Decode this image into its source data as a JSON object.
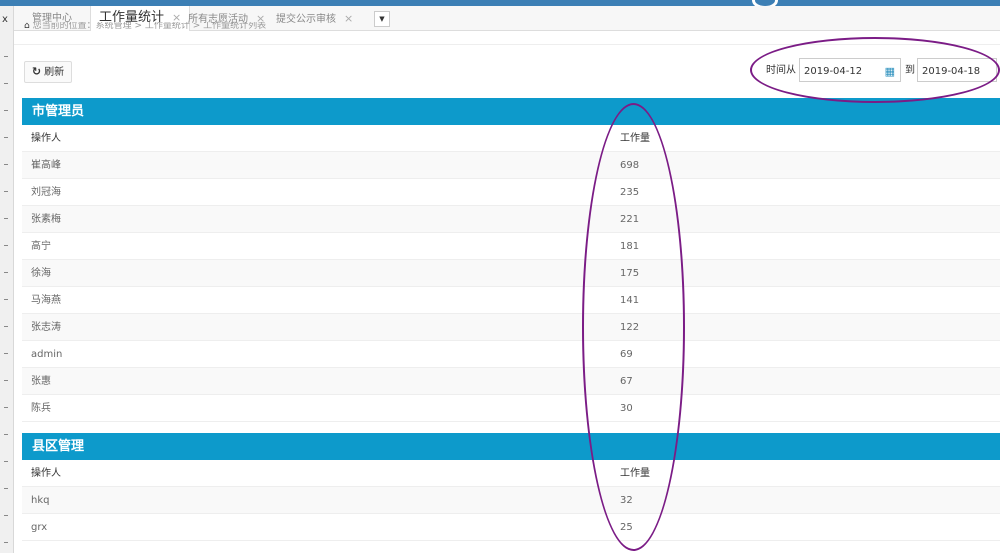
{
  "tabs": [
    {
      "label": "管理中心"
    },
    {
      "label": "工作量统计",
      "active": true
    },
    {
      "label": "所有志愿活动"
    },
    {
      "label": "提交公示审核"
    }
  ],
  "tab_close_glyph": "×",
  "tab_more_glyph": "▼",
  "breadcrumb": {
    "text": "您当前的位置：系统管理 > 工作量统计 > 工作量统计列表"
  },
  "toolbar": {
    "refresh_label": "刷新"
  },
  "date_filter": {
    "from_label": "时间从",
    "start": "2019-04-12",
    "to_label": "到",
    "end": "2019-04-18"
  },
  "sections": [
    {
      "title": "市管理员",
      "columns": [
        "操作人",
        "工作量"
      ],
      "rows": [
        [
          "崔高峰",
          "698"
        ],
        [
          "刘冠海",
          "235"
        ],
        [
          "张素梅",
          "221"
        ],
        [
          "高宁",
          "181"
        ],
        [
          "徐海",
          "175"
        ],
        [
          "马海燕",
          "141"
        ],
        [
          "张志涛",
          "122"
        ],
        [
          "admin",
          "69"
        ],
        [
          "张惠",
          "67"
        ],
        [
          "陈兵",
          "30"
        ]
      ]
    },
    {
      "title": "县区管理",
      "columns": [
        "操作人",
        "工作量"
      ],
      "rows": [
        [
          "hkq",
          "32"
        ],
        [
          "grx",
          "25"
        ]
      ]
    }
  ],
  "colors": {
    "accent": "#0d9acb",
    "annotation": "#7b1c86"
  },
  "icons": {
    "refresh": "refresh-icon",
    "calendar": "calendar-icon",
    "home": "home-icon",
    "close": "close-icon",
    "more": "chevron-down-icon"
  }
}
